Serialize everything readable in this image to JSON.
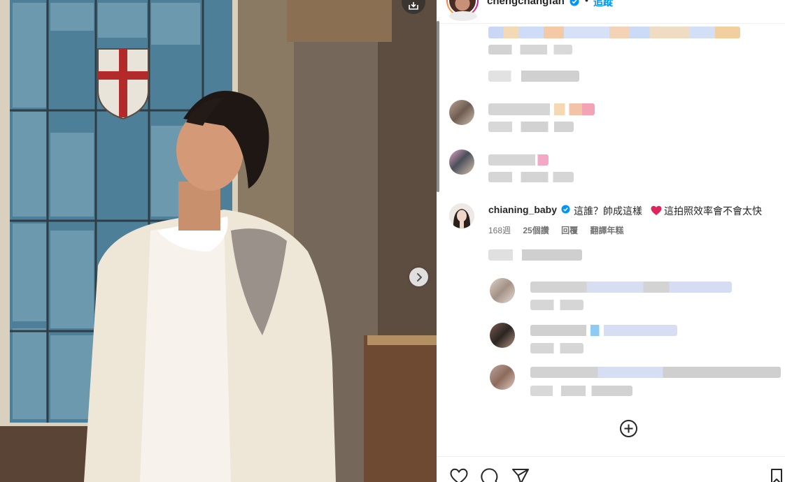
{
  "post": {
    "username": "chengchangfan",
    "follow_label": "追蹤",
    "separator": "•"
  },
  "comment": {
    "username": "chianing_baby",
    "text_before_heart": "這誰？帥成這樣",
    "text_after_heart": "這拍照效率會不會太快",
    "time": "168週",
    "likes": "25個讚",
    "reply_label": "回覆",
    "translate_label": "翻譯年糕"
  },
  "colors": {
    "link_blue": "#0095f6",
    "verified_blue": "#0095f6",
    "heart_pink": "#e0245e",
    "meta_gray": "#737373"
  },
  "icons": [
    "save-icon",
    "chevron-right-icon",
    "verified-badge-icon",
    "heart-emoji-icon",
    "add-circle-icon",
    "like-heart-icon",
    "comment-bubble-icon",
    "share-send-icon",
    "bookmark-icon"
  ]
}
